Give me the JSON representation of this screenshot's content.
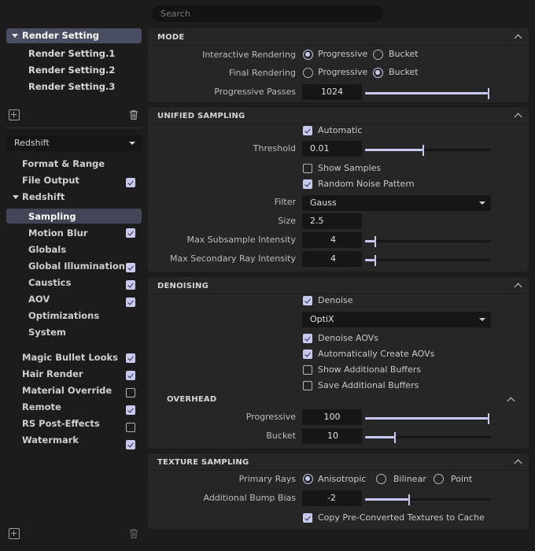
{
  "search": {
    "placeholder": "Search"
  },
  "left": {
    "render_setting_head": "Render Setting",
    "render_settings": [
      "Render Setting.1",
      "Render Setting.2",
      "Render Setting.3"
    ],
    "renderer": "Redshift",
    "tree": {
      "format_range": "Format & Range",
      "file_output": "File Output",
      "redshift": "Redshift",
      "children": [
        {
          "label": "Sampling",
          "checked": null,
          "selected": true
        },
        {
          "label": "Motion Blur",
          "checked": true
        },
        {
          "label": "Globals",
          "checked": null
        },
        {
          "label": "Global Illumination",
          "checked": true
        },
        {
          "label": "Caustics",
          "checked": true
        },
        {
          "label": "AOV",
          "checked": true
        },
        {
          "label": "Optimizations",
          "checked": null
        },
        {
          "label": "System",
          "checked": null
        }
      ],
      "extras": [
        {
          "label": "Magic Bullet Looks",
          "checked": true
        },
        {
          "label": "Hair Render",
          "checked": true
        },
        {
          "label": "Material Override",
          "checked": false
        },
        {
          "label": "Remote",
          "checked": true
        },
        {
          "label": "RS Post-Effects",
          "checked": false
        },
        {
          "label": "Watermark",
          "checked": true
        }
      ]
    }
  },
  "mode": {
    "title": "MODE",
    "interactive_label": "Interactive Rendering",
    "final_label": "Final Rendering",
    "progressive": "Progressive",
    "bucket": "Bucket",
    "interactive_value": "Progressive",
    "final_value": "Bucket",
    "passes_label": "Progressive Passes",
    "passes_value": "1024",
    "passes_slider": 1.0
  },
  "unified": {
    "title": "UNIFIED SAMPLING",
    "automatic": "Automatic",
    "threshold_label": "Threshold",
    "threshold_value": "0.01",
    "threshold_slider": 0.47,
    "show_samples": "Show Samples",
    "random_noise": "Random Noise Pattern",
    "filter_label": "Filter",
    "filter_value": "Gauss",
    "size_label": "Size",
    "size_value": "2.5",
    "max_sub_label": "Max Subsample Intensity",
    "max_sub_value": "4",
    "max_sub_slider": 0.08,
    "max_sec_label": "Max Secondary Ray Intensity",
    "max_sec_value": "4",
    "max_sec_slider": 0.08
  },
  "denoising": {
    "title": "DENOISING",
    "denoise": "Denoise",
    "engine": "OptiX",
    "denoise_aovs": "Denoise AOVs",
    "auto_create": "Automatically Create AOVs",
    "show_buffers": "Show Additional Buffers",
    "save_buffers": "Save Additional Buffers",
    "overhead_title": "OVERHEAD",
    "progressive_label": "Progressive",
    "progressive_value": "100",
    "progressive_slider": 1.0,
    "bucket_label": "Bucket",
    "bucket_value": "10",
    "bucket_slider": 0.24
  },
  "texture": {
    "title": "TEXTURE SAMPLING",
    "primary_label": "Primary Rays",
    "anisotropic": "Anisotropic",
    "bilinear": "Bilinear",
    "point": "Point",
    "primary_value": "Anisotropic",
    "bump_label": "Additional Bump Bias",
    "bump_value": "-2",
    "bump_slider": 0.35,
    "copy_textures": "Copy Pre-Converted Textures to Cache"
  },
  "colors": {
    "accent": "#c7c9ee",
    "panel": "#262626",
    "bg": "#1c1c1c",
    "selected": "#4a4e63"
  }
}
